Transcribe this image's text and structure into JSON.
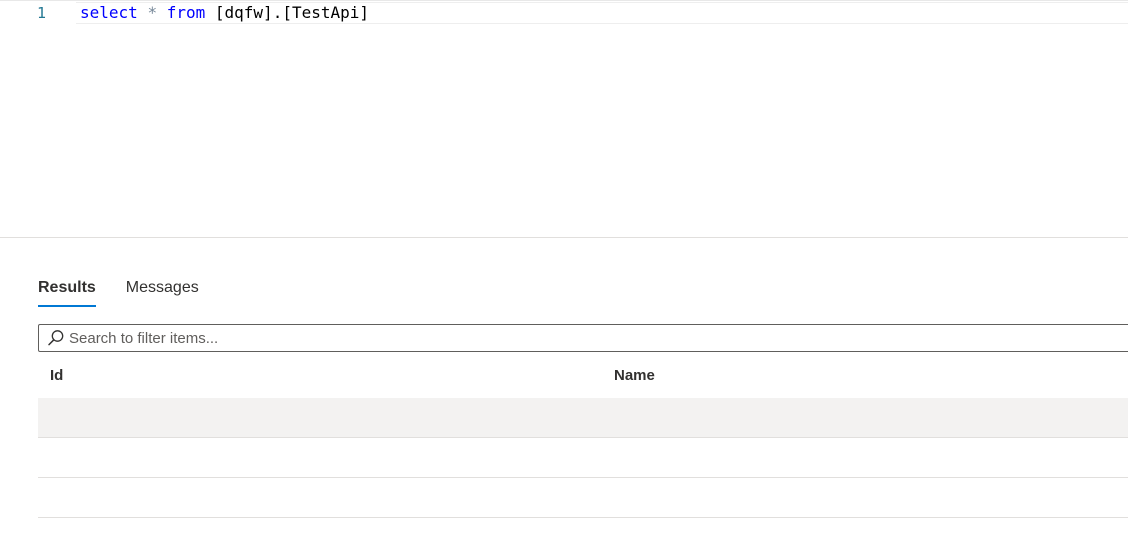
{
  "editor": {
    "line_number": "1",
    "tokens": {
      "select": "select",
      "star": "*",
      "from": "from",
      "table": "[dqfw].[TestApi]"
    }
  },
  "results": {
    "tabs": [
      {
        "label": "Results",
        "active": true
      },
      {
        "label": "Messages",
        "active": false
      }
    ],
    "search": {
      "placeholder": "Search to filter items...",
      "value": ""
    },
    "columns": [
      "Id",
      "Name"
    ],
    "rows": [
      {
        "id": "",
        "name": ""
      },
      {
        "id": "",
        "name": ""
      },
      {
        "id": "",
        "name": ""
      }
    ]
  },
  "colors": {
    "keyword": "#0000ff",
    "operator": "#778899",
    "line_number": "#237893",
    "accent": "#0078d4",
    "shaded_row": "#f3f2f1"
  },
  "icons": {
    "search": "search-icon"
  }
}
